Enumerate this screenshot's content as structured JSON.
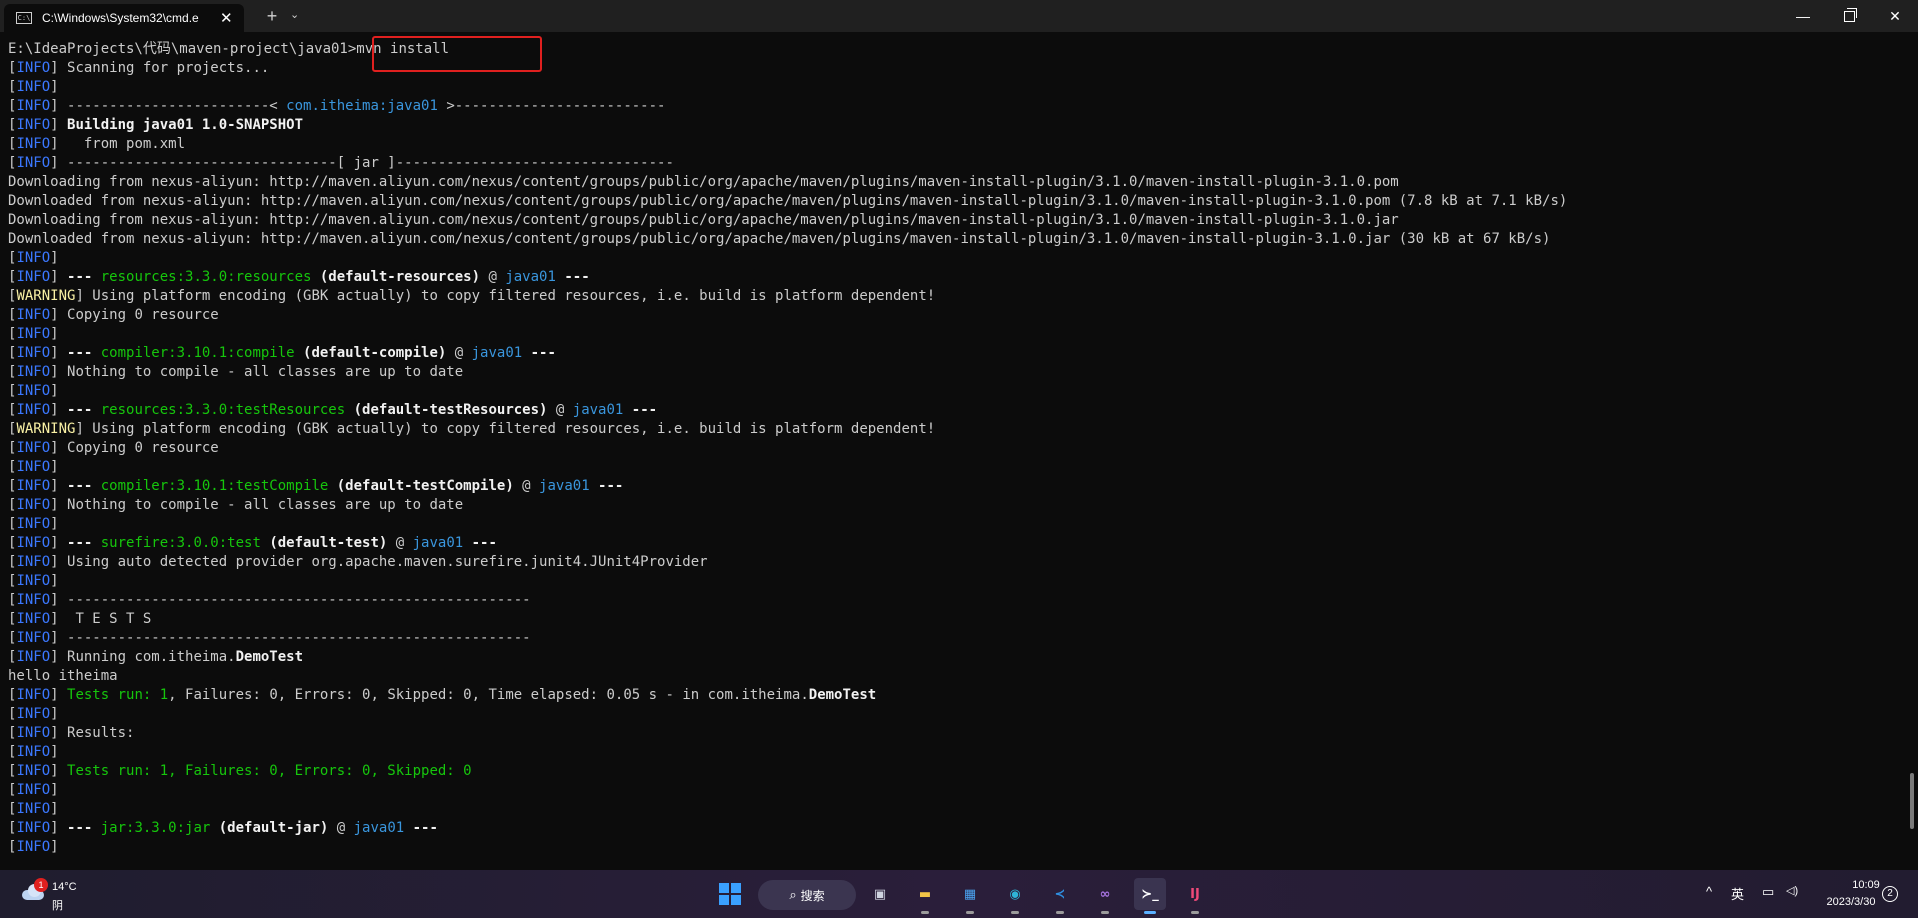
{
  "window": {
    "tab_title": "C:\\Windows\\System32\\cmd.e",
    "tab_icon_text": "C:\\",
    "close_tab_glyph": "✕",
    "new_tab_glyph": "+",
    "tab_menu_glyph": "⌄",
    "minimize_glyph": "—",
    "close_glyph": "✕"
  },
  "terminal": {
    "prompt": "E:\\IdeaProjects\\代码\\maven-project\\java01>",
    "command": "mvn install",
    "lines": [
      [
        [
          "",
          "[INFO] Scanning for projects..."
        ]
      ],
      [
        [
          "",
          "[INFO]"
        ]
      ],
      [
        [
          "",
          "[INFO] ------------------------< "
        ],
        [
          "blue",
          "com.itheima:java01"
        ],
        [
          "",
          " >-------------------------"
        ]
      ],
      [
        [
          "",
          "[INFO] "
        ],
        [
          "bold",
          "Building java01 1.0-SNAPSHOT"
        ]
      ],
      [
        [
          "",
          "[INFO]   from pom.xml"
        ]
      ],
      [
        [
          "",
          "[INFO] --------------------------------[ jar ]---------------------------------"
        ]
      ],
      [
        [
          "",
          "Downloading from nexus-aliyun: http://maven.aliyun.com/nexus/content/groups/public/org/apache/maven/plugins/maven-install-plugin/3.1.0/maven-install-plugin-3.1.0.pom"
        ]
      ],
      [
        [
          "",
          "Downloaded from nexus-aliyun: http://maven.aliyun.com/nexus/content/groups/public/org/apache/maven/plugins/maven-install-plugin/3.1.0/maven-install-plugin-3.1.0.pom (7.8 kB at 7.1 kB/s)"
        ]
      ],
      [
        [
          "",
          "Downloading from nexus-aliyun: http://maven.aliyun.com/nexus/content/groups/public/org/apache/maven/plugins/maven-install-plugin/3.1.0/maven-install-plugin-3.1.0.jar"
        ]
      ],
      [
        [
          "",
          "Downloaded from nexus-aliyun: http://maven.aliyun.com/nexus/content/groups/public/org/apache/maven/plugins/maven-install-plugin/3.1.0/maven-install-plugin-3.1.0.jar (30 kB at 67 kB/s)"
        ]
      ],
      [
        [
          "",
          "[INFO]"
        ]
      ],
      [
        [
          "",
          "[INFO] "
        ],
        [
          "bold",
          "--- "
        ],
        [
          "green",
          "resources:3.3.0:resources"
        ],
        [
          "bold",
          " (default-resources)"
        ],
        [
          "",
          " @ "
        ],
        [
          "blue",
          "java01"
        ],
        [
          "bold",
          " ---"
        ]
      ],
      [
        [
          "",
          "[WARNING] Using platform encoding (GBK actually) to copy filtered resources, i.e. build is platform dependent!"
        ]
      ],
      [
        [
          "",
          "[INFO] Copying 0 resource"
        ]
      ],
      [
        [
          "",
          "[INFO]"
        ]
      ],
      [
        [
          "",
          "[INFO] "
        ],
        [
          "bold",
          "--- "
        ],
        [
          "green",
          "compiler:3.10.1:compile"
        ],
        [
          "bold",
          " (default-compile)"
        ],
        [
          "",
          " @ "
        ],
        [
          "blue",
          "java01"
        ],
        [
          "bold",
          " ---"
        ]
      ],
      [
        [
          "",
          "[INFO] Nothing to compile - all classes are up to date"
        ]
      ],
      [
        [
          "",
          "[INFO]"
        ]
      ],
      [
        [
          "",
          "[INFO] "
        ],
        [
          "bold",
          "--- "
        ],
        [
          "green",
          "resources:3.3.0:testResources"
        ],
        [
          "bold",
          " (default-testResources)"
        ],
        [
          "",
          " @ "
        ],
        [
          "blue",
          "java01"
        ],
        [
          "bold",
          " ---"
        ]
      ],
      [
        [
          "",
          "[WARNING] Using platform encoding (GBK actually) to copy filtered resources, i.e. build is platform dependent!"
        ]
      ],
      [
        [
          "",
          "[INFO] Copying 0 resource"
        ]
      ],
      [
        [
          "",
          "[INFO]"
        ]
      ],
      [
        [
          "",
          "[INFO] "
        ],
        [
          "bold",
          "--- "
        ],
        [
          "green",
          "compiler:3.10.1:testCompile"
        ],
        [
          "bold",
          " (default-testCompile)"
        ],
        [
          "",
          " @ "
        ],
        [
          "blue",
          "java01"
        ],
        [
          "bold",
          " ---"
        ]
      ],
      [
        [
          "",
          "[INFO] Nothing to compile - all classes are up to date"
        ]
      ],
      [
        [
          "",
          "[INFO]"
        ]
      ],
      [
        [
          "",
          "[INFO] "
        ],
        [
          "bold",
          "--- "
        ],
        [
          "green",
          "surefire:3.0.0:test"
        ],
        [
          "bold",
          " (default-test)"
        ],
        [
          "",
          " @ "
        ],
        [
          "blue",
          "java01"
        ],
        [
          "bold",
          " ---"
        ]
      ],
      [
        [
          "",
          "[INFO] Using auto detected provider org.apache.maven.surefire.junit4.JUnit4Provider"
        ]
      ],
      [
        [
          "",
          "[INFO]"
        ]
      ],
      [
        [
          "",
          "[INFO] -------------------------------------------------------"
        ]
      ],
      [
        [
          "",
          "[INFO]  T E S T S"
        ]
      ],
      [
        [
          "",
          "[INFO] -------------------------------------------------------"
        ]
      ],
      [
        [
          "",
          "[INFO] Running com.itheima."
        ],
        [
          "bold",
          "DemoTest"
        ]
      ],
      [
        [
          "",
          "hello itheima"
        ]
      ],
      [
        [
          "",
          "[INFO] "
        ],
        [
          "green",
          "Tests run: 1"
        ],
        [
          "",
          ", Failures: 0, Errors: 0, Skipped: 0, Time elapsed: 0.05 s - in com.itheima."
        ],
        [
          "bold",
          "DemoTest"
        ]
      ],
      [
        [
          "",
          "[INFO]"
        ]
      ],
      [
        [
          "",
          "[INFO] Results:"
        ]
      ],
      [
        [
          "",
          "[INFO]"
        ]
      ],
      [
        [
          "",
          "[INFO] "
        ],
        [
          "green",
          "Tests run: 1, Failures: 0, Errors: 0, Skipped: 0"
        ]
      ],
      [
        [
          "",
          "[INFO]"
        ]
      ],
      [
        [
          "",
          "[INFO]"
        ]
      ],
      [
        [
          "",
          "[INFO] "
        ],
        [
          "bold",
          "--- "
        ],
        [
          "green",
          "jar:3.3.0:jar"
        ],
        [
          "bold",
          " (default-jar)"
        ],
        [
          "",
          " @ "
        ],
        [
          "blue",
          "java01"
        ],
        [
          "bold",
          " ---"
        ]
      ],
      [
        [
          "",
          "[INFO]"
        ]
      ]
    ]
  },
  "taskbar": {
    "weather_badge": "1",
    "weather_temp": "14°C",
    "weather_condition": "阴",
    "search_label": "搜索",
    "search_glyph": "⌕",
    "apps": [
      {
        "name": "task-view",
        "mark": "▣",
        "color": "#cfd4e0",
        "running": false
      },
      {
        "name": "file-explorer",
        "mark": "▬",
        "color": "#f2c447",
        "running": true
      },
      {
        "name": "microsoft-store",
        "mark": "▦",
        "color": "#4aa3f0",
        "running": true
      },
      {
        "name": "edge-browser",
        "mark": "◉",
        "color": "#2fb6d6",
        "running": true
      },
      {
        "name": "vscode",
        "mark": "≺",
        "color": "#2f8fe0",
        "running": true
      },
      {
        "name": "visual-studio",
        "mark": "∞",
        "color": "#a774e0",
        "running": true
      },
      {
        "name": "terminal",
        "mark": "≻_",
        "color": "#ffffff",
        "running": true,
        "active": true
      },
      {
        "name": "intellij-idea",
        "mark": "IJ",
        "color": "#f04a7a",
        "running": true
      }
    ],
    "tray_chevron": "^",
    "ime": "英",
    "network_glyph": "▭",
    "volume_glyph": "◁)",
    "time": "10:09",
    "date": "2023/3/30",
    "notification_count": "2"
  },
  "colors": {
    "info": "#3b78ff",
    "warning": "#f9f1a5",
    "green": "#16c60c",
    "blue": "#3a96dd",
    "highlight": "#e0201f"
  }
}
